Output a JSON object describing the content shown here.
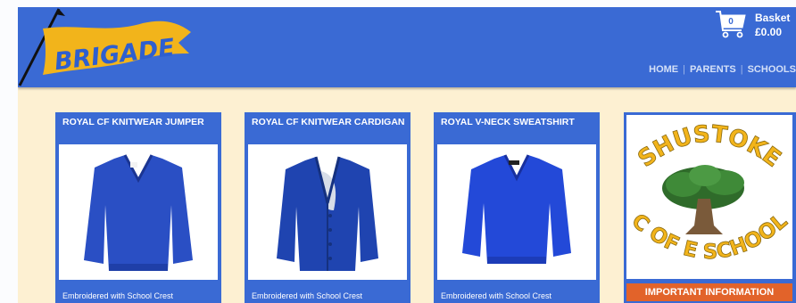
{
  "brand": {
    "logo_text": "BRIGADE",
    "logo_color": "#f2b41b"
  },
  "basket": {
    "title": "Basket",
    "count": "0",
    "total": "£0.00"
  },
  "nav": {
    "items": [
      "HOME",
      "PARENTS",
      "SCHOOLS"
    ]
  },
  "products": [
    {
      "title": "ROYAL CF KNITWEAR JUMPER",
      "description": "Embroidered with School Crest",
      "image_icon": "jumper-image"
    },
    {
      "title": "ROYAL CF KNITWEAR CARDIGAN",
      "description": "Embroidered with School Crest",
      "image_icon": "cardigan-image"
    },
    {
      "title": "ROYAL V-NECK SWEATSHIRT",
      "description": "Embroidered with School Crest",
      "image_icon": "sweatshirt-image"
    }
  ],
  "school": {
    "crest_top": "SHUSTOKE",
    "crest_bottom": "C OF E SCHOOL",
    "info_button": "IMPORTANT INFORMATION"
  },
  "colors": {
    "header_blue": "#3a6ad4",
    "page_bg": "#fdf0d2",
    "garment_blue": "#2a4fc4",
    "info_orange": "#e2632a",
    "crest_yellow": "#f2b41b"
  }
}
